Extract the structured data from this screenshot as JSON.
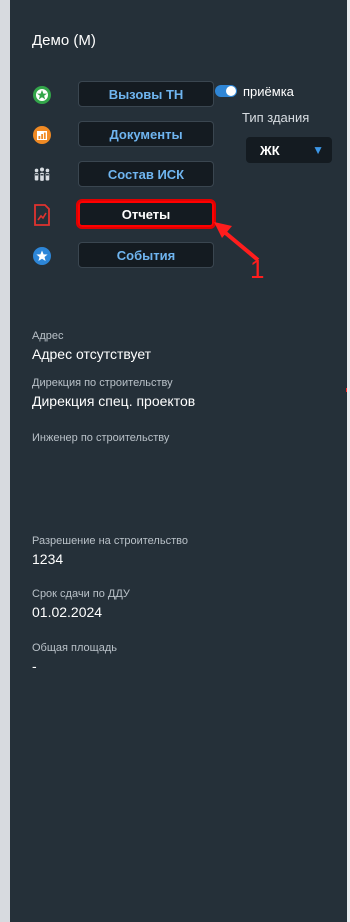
{
  "panel": {
    "title": "Демо (М)"
  },
  "menu": {
    "items": [
      {
        "label": "Вызовы ТН",
        "icon": "green-star-badge-icon"
      },
      {
        "label": "Документы",
        "icon": "orange-chart-icon"
      },
      {
        "label": "Состав ИСК",
        "icon": "people-group-icon"
      },
      {
        "label": "Отчеты",
        "icon": "red-report-icon",
        "selected": true
      },
      {
        "label": "События",
        "icon": "blue-star-icon"
      }
    ]
  },
  "controls": {
    "toggle_label": "приёмка",
    "toggle_on": true,
    "building_type_label": "Тип здания",
    "building_type_value": "ЖК"
  },
  "annotation": {
    "number": "1"
  },
  "info": {
    "address_label": "Адрес",
    "address_value": "Адрес отсутствует",
    "directorate_label": "Дирекция по строительству",
    "directorate_value": "Дирекция спец. проектов",
    "engineer_label": "Инженер по строительству",
    "engineer_value": "",
    "permit_label": "Разрешение на строительство",
    "permit_value": "1234",
    "deadline_label": "Срок сдачи по ДДУ",
    "deadline_value": "01.02.2024",
    "area_label": "Общая площадь",
    "area_value": "-"
  },
  "colors": {
    "panel_bg": "#253039",
    "button_bg": "#141b21",
    "button_text": "#6fb5f0",
    "highlight": "#ff0000",
    "toggle_accent": "#2f86d6"
  }
}
